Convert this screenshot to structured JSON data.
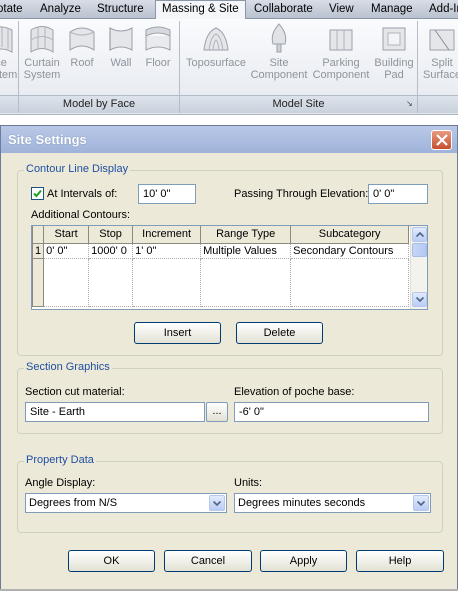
{
  "ribbon": {
    "tabs": [
      "otate",
      "Analyze",
      "Structure",
      "Massing & Site",
      "Collaborate",
      "View",
      "Manage",
      "Add-In"
    ],
    "active_tab": "Massing & Site",
    "groups": [
      {
        "label": "Model by Face",
        "buttons": [
          {
            "label_1": "ce",
            "label_2": "ystem",
            "icon": "curtain-system-icon"
          },
          {
            "label_1": "Curtain",
            "label_2": "System",
            "icon": "curtain-system-icon"
          },
          {
            "label_1": "Roof",
            "label_2": "",
            "icon": "roof-by-face-icon"
          },
          {
            "label_1": "Wall",
            "label_2": "",
            "icon": "wall-by-face-icon"
          },
          {
            "label_1": "Floor",
            "label_2": "",
            "icon": "floor-by-face-icon"
          }
        ]
      },
      {
        "label": "Model Site",
        "buttons": [
          {
            "label_1": "Toposurface",
            "label_2": "",
            "icon": "toposurface-icon"
          },
          {
            "label_1": "Site",
            "label_2": "Component",
            "icon": "tree-icon"
          },
          {
            "label_1": "Parking",
            "label_2": "Component",
            "icon": "parking-icon"
          },
          {
            "label_1": "Building",
            "label_2": "Pad",
            "icon": "building-pad-icon"
          }
        ]
      },
      {
        "label": "",
        "buttons": [
          {
            "label_1": "Split",
            "label_2": "Surface",
            "icon": "split-surface-icon"
          }
        ]
      }
    ]
  },
  "dialog": {
    "title": "Site Settings",
    "contour": {
      "legend": "Contour Line Display",
      "at_intervals_label": "At Intervals of:",
      "at_intervals_checked": true,
      "interval_value": "10'  0\"",
      "passing_label": "Passing Through Elevation:",
      "passing_value": "0'  0\"",
      "additional_label": "Additional Contours:",
      "columns": [
        "Start",
        "Stop",
        "Increment",
        "Range Type",
        "Subcategory"
      ],
      "rows": [
        {
          "num": "1",
          "start": "0'  0\"",
          "stop": "1000'  0",
          "increment": "1'  0\"",
          "range_type": "Multiple Values",
          "subcategory": "Secondary Contours"
        }
      ],
      "insert_label": "Insert",
      "delete_label": "Delete"
    },
    "section": {
      "legend": "Section Graphics",
      "material_label": "Section cut material:",
      "material_value": "Site - Earth",
      "browse_label": "...",
      "poche_label": "Elevation of poche base:",
      "poche_value": "-6'  0\""
    },
    "property": {
      "legend": "Property Data",
      "angle_label": "Angle Display:",
      "angle_value": "Degrees from N/S",
      "units_label": "Units:",
      "units_value": "Degrees minutes seconds"
    },
    "buttons": {
      "ok": "OK",
      "cancel": "Cancel",
      "apply": "Apply",
      "help": "Help"
    }
  },
  "colors": {
    "legend_text": "#1f4fa3",
    "dialog_bg": "#ece9d8",
    "titlebar": "#9fb3da",
    "close_button": "#c5502f"
  }
}
